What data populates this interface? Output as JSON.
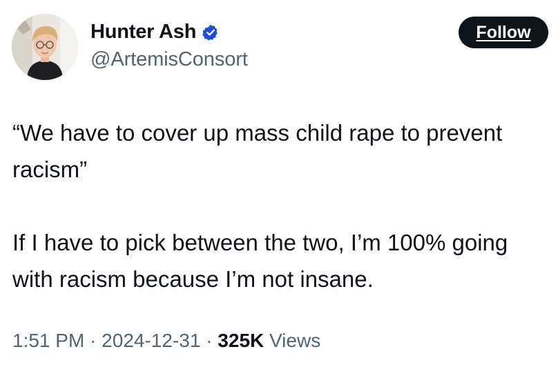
{
  "author": {
    "display_name": "Hunter Ash",
    "handle": "@ArtemisConsort",
    "verified_icon": "verified-badge-icon",
    "verified_color": "#1d4ed8"
  },
  "follow_button": {
    "label": "Follow"
  },
  "tweet": {
    "lines": [
      "“We have to cover up mass child rape to prevent",
      "racism”",
      "If I have to pick between the two, I’m 100% going",
      "with racism because I’m not insane."
    ]
  },
  "meta": {
    "time": "1:51 PM",
    "separator": "·",
    "date": "2024-12-31",
    "views_count": "325K",
    "views_label": "Views"
  },
  "colors": {
    "text_primary": "#0f1419",
    "text_secondary": "#536471",
    "button_bg": "#0f1419",
    "button_text": "#ffffff"
  }
}
